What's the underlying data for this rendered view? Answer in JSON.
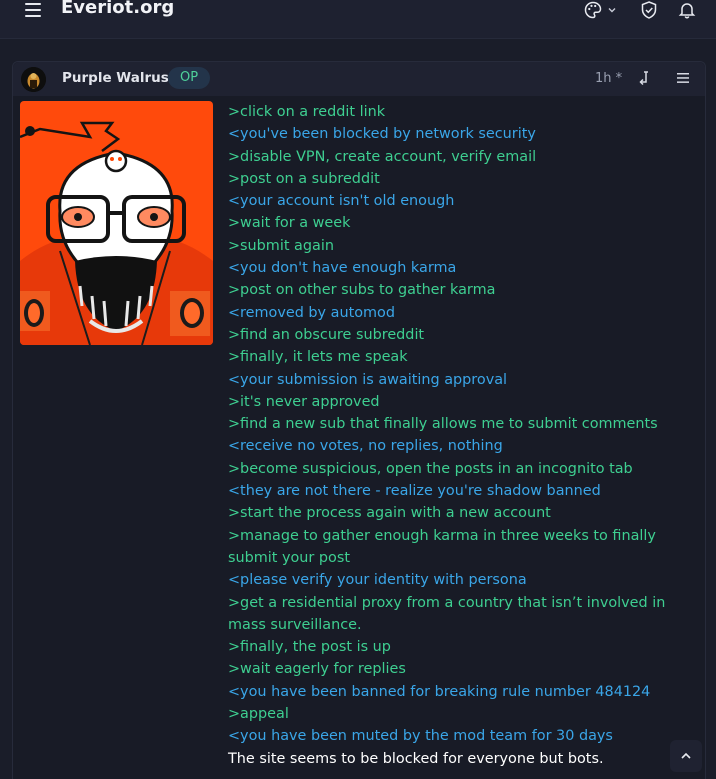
{
  "header": {
    "site_title": "Everiot.org",
    "icons": [
      "menu-icon",
      "palette-icon",
      "chevron-down-icon",
      "shield-check-icon",
      "bell-icon"
    ]
  },
  "post": {
    "author": "Purple Walrus",
    "badge": "OP",
    "time": "1h *",
    "lines": [
      {
        "text": ">click on a reddit link",
        "kind": "gt"
      },
      {
        "text": "<you've been blocked by network security",
        "kind": "lt"
      },
      {
        "text": ">disable VPN, create account, verify email",
        "kind": "gt"
      },
      {
        "text": ">post on a subreddit",
        "kind": "gt"
      },
      {
        "text": "<your account isn't old enough",
        "kind": "lt"
      },
      {
        "text": ">wait for a week",
        "kind": "gt"
      },
      {
        "text": ">submit again",
        "kind": "gt"
      },
      {
        "text": "<you don't have enough karma",
        "kind": "lt"
      },
      {
        "text": ">post on other subs to gather karma",
        "kind": "gt"
      },
      {
        "text": "<removed by automod",
        "kind": "lt"
      },
      {
        "text": ">find an obscure subreddit",
        "kind": "gt"
      },
      {
        "text": ">finally, it lets me speak",
        "kind": "gt"
      },
      {
        "text": "<your submission is awaiting approval",
        "kind": "lt"
      },
      {
        "text": ">it's never approved",
        "kind": "gt"
      },
      {
        "text": ">find a new sub that finally allows me to submit comments",
        "kind": "gt"
      },
      {
        "text": "<receive no votes, no replies, nothing",
        "kind": "lt"
      },
      {
        "text": ">become suspicious, open the posts in an incognito tab",
        "kind": "gt"
      },
      {
        "text": "<they are not there - realize you're shadow banned",
        "kind": "lt"
      },
      {
        "text": ">start the process again with a new account",
        "kind": "gt"
      },
      {
        "text": ">manage to gather enough karma in three weeks to finally submit your post",
        "kind": "gt"
      },
      {
        "text": "<please verify your identity with persona",
        "kind": "lt"
      },
      {
        "text": ">get a residential proxy from a country that isn’t involved in mass surveillance.",
        "kind": "gt"
      },
      {
        "text": ">finally, the post is up",
        "kind": "gt"
      },
      {
        "text": ">wait eagerly for replies",
        "kind": "gt"
      },
      {
        "text": "<you have been banned for breaking rule number 484124",
        "kind": "lt"
      },
      {
        "text": ">appeal",
        "kind": "gt"
      },
      {
        "text": "<you have been muted by the mod team for 30 days",
        "kind": "lt"
      },
      {
        "text": "The site seems to be blocked for everyone but bots.",
        "kind": "plain"
      }
    ]
  },
  "colors": {
    "background": "#1a1d29",
    "greentext": "#3ecf91",
    "bluetext": "#3aa6e8",
    "op_badge_text": "#4fd19a",
    "thumbnail_bg": "#ff4500"
  }
}
